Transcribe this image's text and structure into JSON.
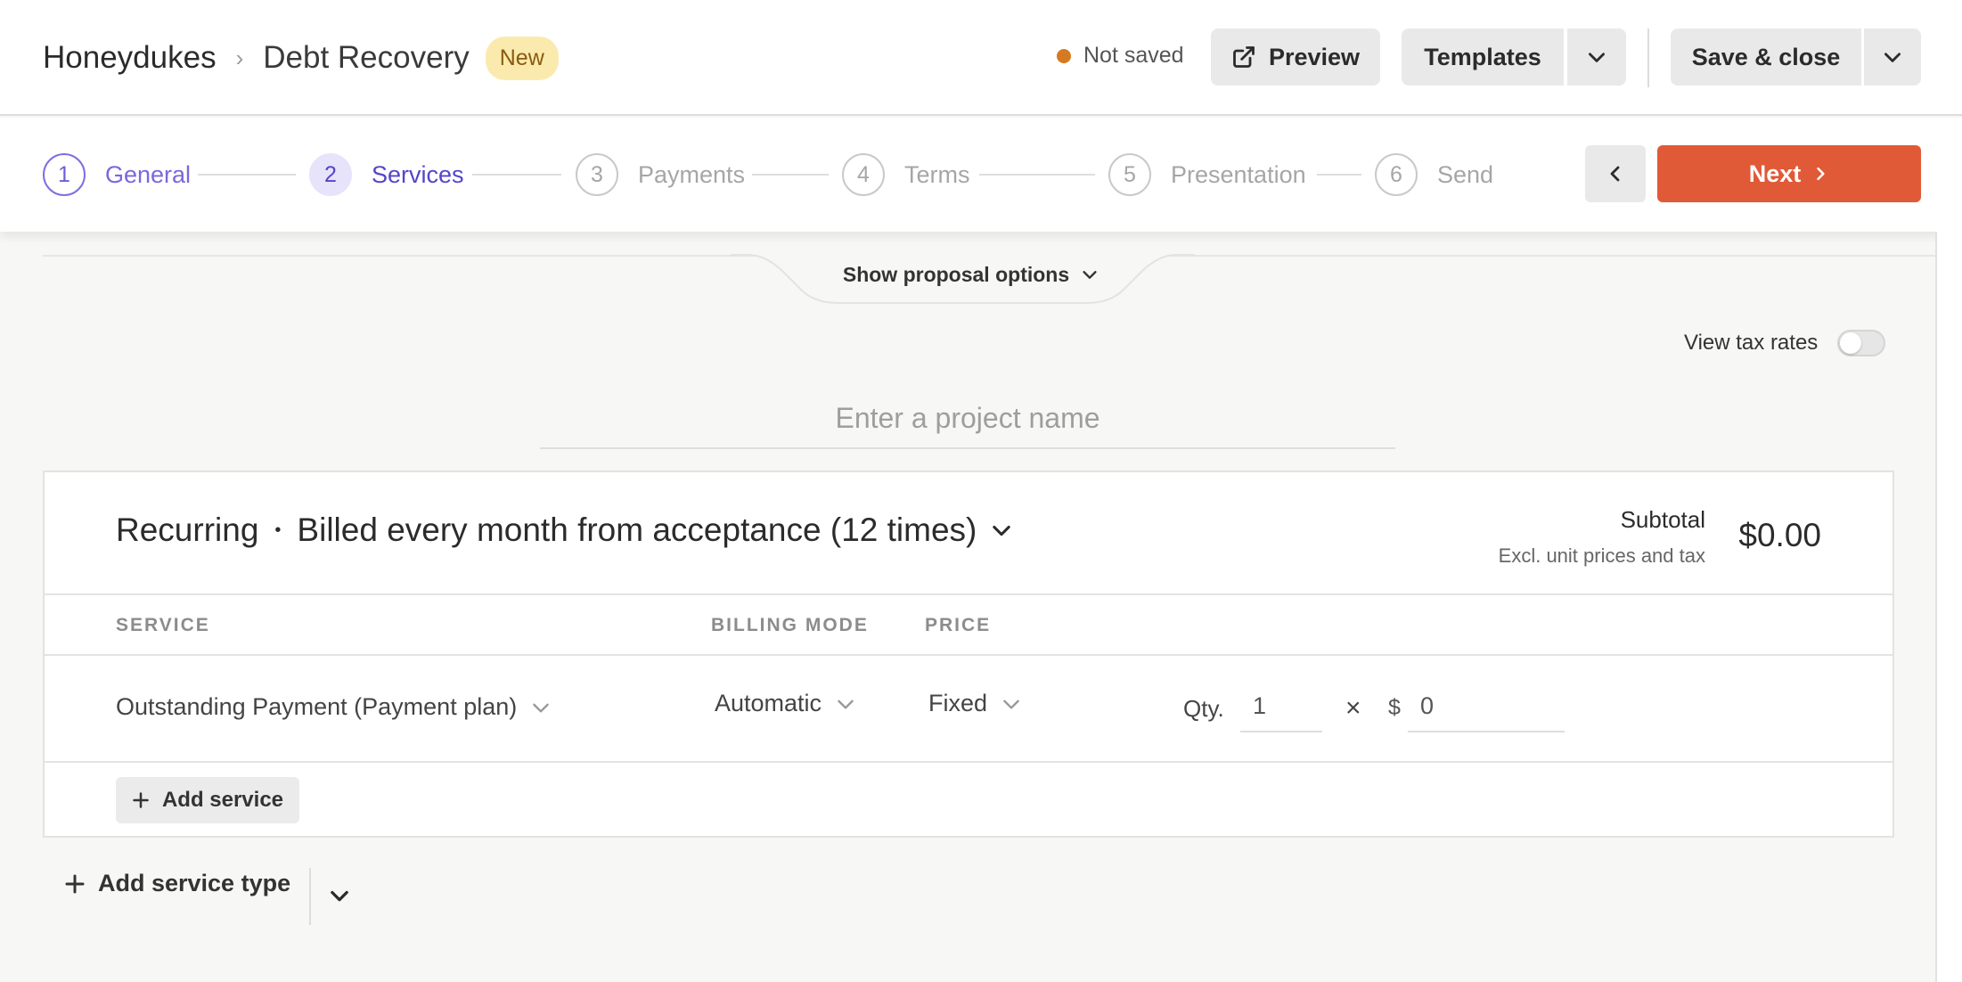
{
  "header": {
    "client": "Honeydukes",
    "project": "Debt Recovery",
    "badge": "New",
    "status": "Not saved",
    "preview_label": "Preview",
    "templates_label": "Templates",
    "save_label": "Save & close",
    "status_color": "#d67a22"
  },
  "steps": [
    {
      "num": "1",
      "label": "General"
    },
    {
      "num": "2",
      "label": "Services"
    },
    {
      "num": "3",
      "label": "Payments"
    },
    {
      "num": "4",
      "label": "Terms"
    },
    {
      "num": "5",
      "label": "Presentation"
    },
    {
      "num": "6",
      "label": "Send"
    }
  ],
  "nav": {
    "next_label": "Next",
    "accent": "#e05a37"
  },
  "options": {
    "label": "Show proposal options"
  },
  "tax": {
    "label": "View tax rates",
    "enabled": false
  },
  "project_name": {
    "placeholder": "Enter a project name",
    "value": ""
  },
  "card": {
    "type": "Recurring",
    "billing": "Billed every month from acceptance (12 times)",
    "subtotal_label": "Subtotal",
    "subtotal_note": "Excl. unit prices and tax",
    "subtotal_value": "$0.00",
    "columns": {
      "service": "SERVICE",
      "billing_mode": "BILLING MODE",
      "price": "PRICE"
    },
    "row": {
      "service": "Outstanding Payment (Payment plan)",
      "billing_mode": "Automatic",
      "price_type": "Fixed",
      "qty_label": "Qty.",
      "qty": "1",
      "times": "×",
      "currency": "$",
      "unit_price": "0"
    },
    "add_service_label": "Add service"
  },
  "footer": {
    "add_service_type_label": "Add service type"
  }
}
